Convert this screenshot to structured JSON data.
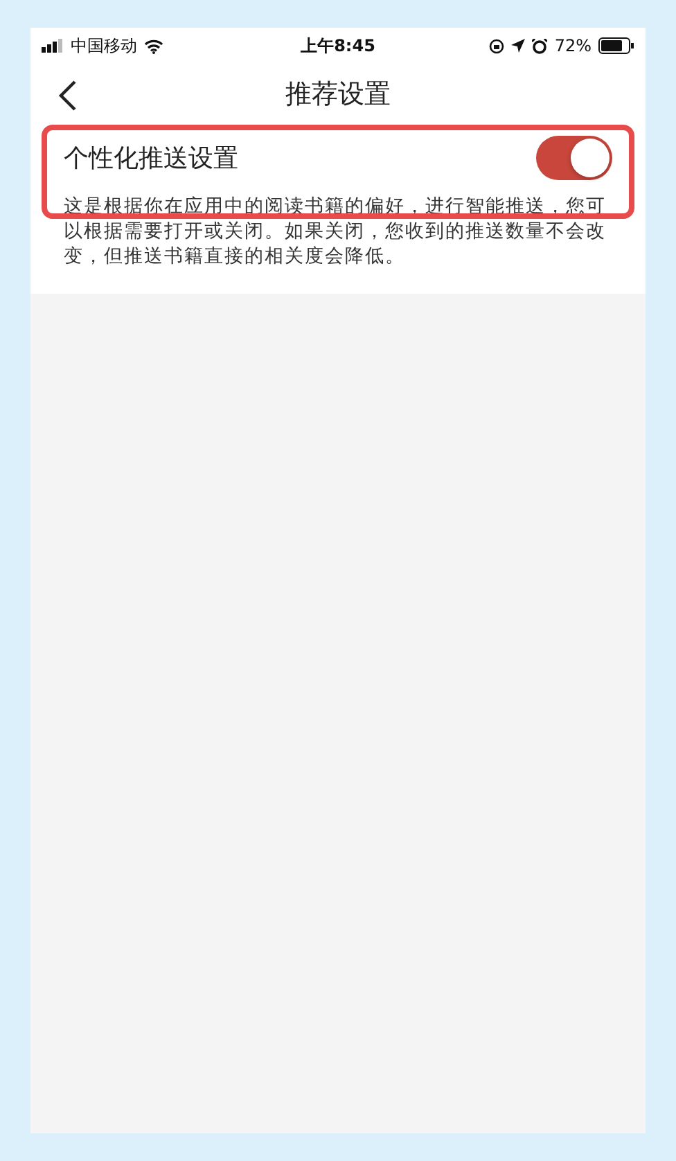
{
  "status_bar": {
    "carrier": "中国移动",
    "time": "上午8:45",
    "battery": "72%"
  },
  "nav": {
    "title": "推荐设置"
  },
  "setting": {
    "label": "个性化推送设置",
    "on": true,
    "highlighted": true,
    "description": "这是根据你在应用中的阅读书籍的偏好，进行智能推送，您可以根据需要打开或关闭。如果关闭，您收到的推送数量不会改变，但推送书籍直接的相关度会降低。"
  }
}
